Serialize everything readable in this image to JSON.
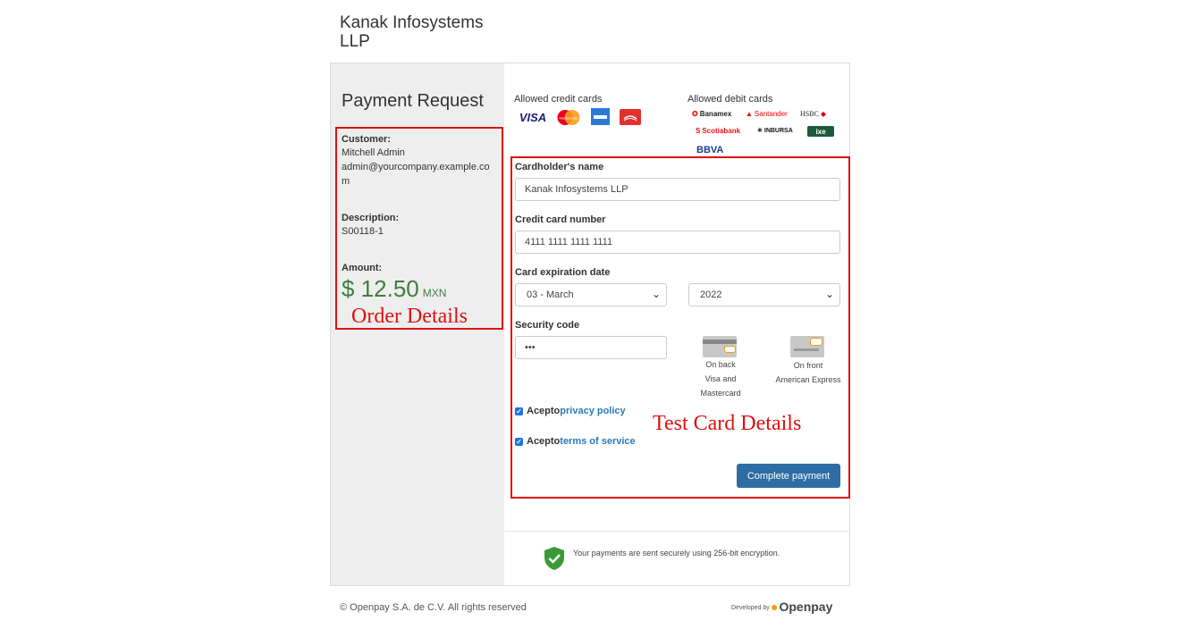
{
  "merchant": {
    "name": "Kanak Infosystems LLP"
  },
  "order": {
    "title": "Payment Request",
    "customer_label": "Customer:",
    "customer_name": "Mitchell Admin",
    "customer_email": "admin@yourcompany.example.com",
    "description_label": "Description:",
    "description_value": "S00118-1",
    "amount_label": "Amount:",
    "amount_value": "$ 12.50",
    "currency": "MXN"
  },
  "annotations": {
    "order_details": "Order Details",
    "test_card_details": "Test Card Details",
    "color": "#dd1111"
  },
  "cards": {
    "credit_title": "Allowed credit cards",
    "debit_title": "Allowed debit cards",
    "credit_logos": [
      "VISA",
      "MasterCard",
      "American Express",
      "Carnet"
    ],
    "debit_logos": [
      "Banamex",
      "Santander",
      "HSBC",
      "Scotiabank",
      "INBURSA",
      "ixe",
      "BBVA"
    ]
  },
  "form": {
    "holder_label": "Cardholder's name",
    "holder_value": "Kanak Infosystems LLP",
    "number_label": "Credit card number",
    "number_value": "4111 1111 1111 1111",
    "expiry_label": "Card expiration date",
    "expiry_month": "03 - March",
    "expiry_year": "2022",
    "cvv_label": "Security code",
    "cvv_value": "•••",
    "cvv_back_line1": "On back",
    "cvv_back_line2": "Visa and Mastercard",
    "cvv_front_line1": "On front",
    "cvv_front_line2": "American Express",
    "privacy_prefix": "Acepto",
    "privacy_link": "privacy policy",
    "terms_prefix": "Acepto",
    "terms_link": "terms of service",
    "submit_label": "Complete payment"
  },
  "security": {
    "text": "Your payments are sent securely using 256-bit encryption."
  },
  "footer": {
    "copyright": "© Openpay S.A. de C.V. All rights reserved",
    "developed_by": "Developed by",
    "brand": "Openpay"
  },
  "colors": {
    "accent": "#2e6da4",
    "amount": "#3f7f3f",
    "link": "#2a7ab8"
  }
}
